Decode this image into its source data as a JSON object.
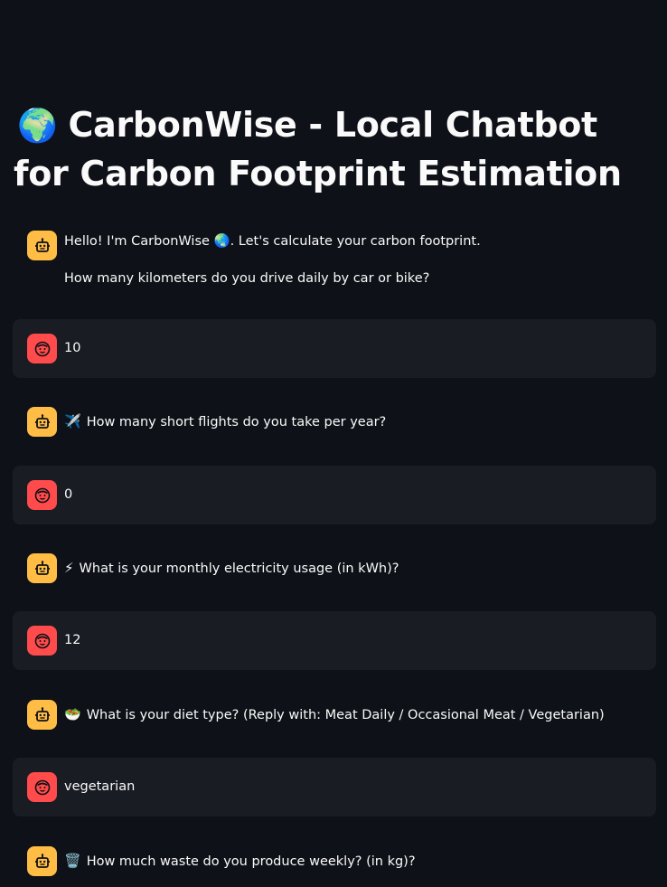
{
  "header": {
    "title_icon": "globe-icon",
    "title_emoji": "🌍",
    "title": "CarbonWise - Local Chatbot for Carbon Footprint Estimation"
  },
  "chat": {
    "messages": [
      {
        "role": "assistant",
        "avatar_icon": "robot-icon",
        "line1": "Hello! I'm CarbonWise 🌏. Let's calculate your carbon footprint.",
        "line2": "How many kilometers do you drive daily by car or bike?"
      },
      {
        "role": "user",
        "avatar_icon": "face-icon",
        "text": "10"
      },
      {
        "role": "assistant",
        "avatar_icon": "robot-icon",
        "emoji": "✈️",
        "text": "How many short flights do you take per year?"
      },
      {
        "role": "user",
        "avatar_icon": "face-icon",
        "text": "0"
      },
      {
        "role": "assistant",
        "avatar_icon": "robot-icon",
        "emoji": "⚡",
        "text": "What is your monthly electricity usage (in kWh)?"
      },
      {
        "role": "user",
        "avatar_icon": "face-icon",
        "text": "12"
      },
      {
        "role": "assistant",
        "avatar_icon": "robot-icon",
        "emoji": "🥗",
        "text": "What is your diet type? (Reply with: Meat Daily / Occasional Meat / Vegetarian)"
      },
      {
        "role": "user",
        "avatar_icon": "face-icon",
        "text": "vegetarian"
      },
      {
        "role": "assistant",
        "avatar_icon": "robot-icon",
        "emoji": "🗑️",
        "text": "How much waste do you produce weekly? (in kg)?"
      }
    ]
  },
  "colors": {
    "background": "#0e1117",
    "user_bubble": "#1a1c24",
    "assistant_avatar": "#ffbd45",
    "user_avatar": "#ff4b4b",
    "text": "#fafafa"
  }
}
